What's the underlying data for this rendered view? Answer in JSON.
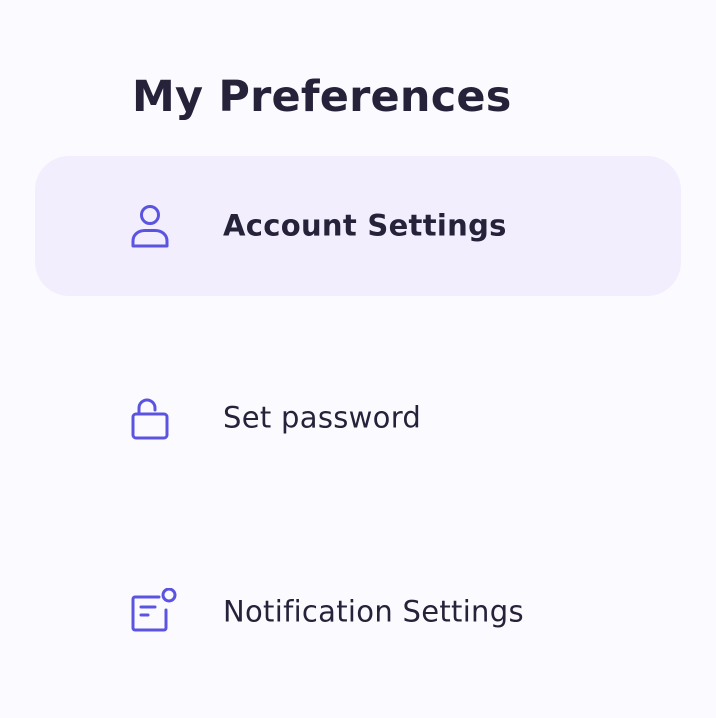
{
  "page": {
    "title": "My Preferences"
  },
  "menu": {
    "items": [
      {
        "label": "Account Settings",
        "icon": "user-icon",
        "active": true
      },
      {
        "label": "Set password",
        "icon": "unlock-icon",
        "active": false
      },
      {
        "label": "Notification Settings",
        "icon": "notification-icon",
        "active": false
      }
    ]
  },
  "colors": {
    "accent": "#5b54e0",
    "active_background": "#f2eefd",
    "page_background": "#fbfaff",
    "text": "#25223a"
  }
}
